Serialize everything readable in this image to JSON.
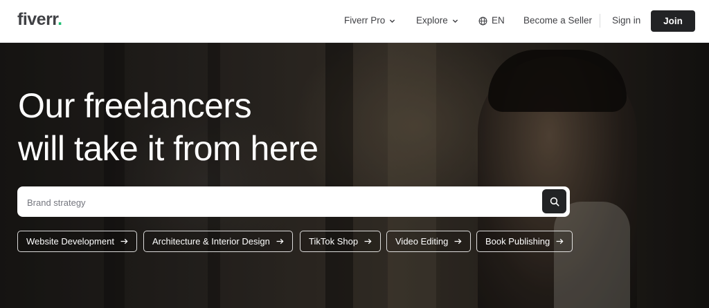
{
  "header": {
    "logo_text": "fiverr",
    "logo_dot": ".",
    "nav": {
      "fiverr_pro": "Fiverr Pro",
      "explore": "Explore",
      "language": "EN",
      "become_seller": "Become a Seller",
      "sign_in": "Sign in",
      "join": "Join"
    }
  },
  "hero": {
    "headline_line1": "Our freelancers",
    "headline_line2": "will take it from here",
    "search": {
      "placeholder": "Brand strategy",
      "value": ""
    },
    "chips": [
      {
        "label": "Website Development"
      },
      {
        "label": "Architecture & Interior Design"
      },
      {
        "label": "TikTok Shop"
      },
      {
        "label": "Video Editing"
      },
      {
        "label": "Book Publishing"
      }
    ]
  },
  "colors": {
    "brand_green": "#1dbf73",
    "text_dark": "#404145",
    "button_dark": "#222325"
  }
}
